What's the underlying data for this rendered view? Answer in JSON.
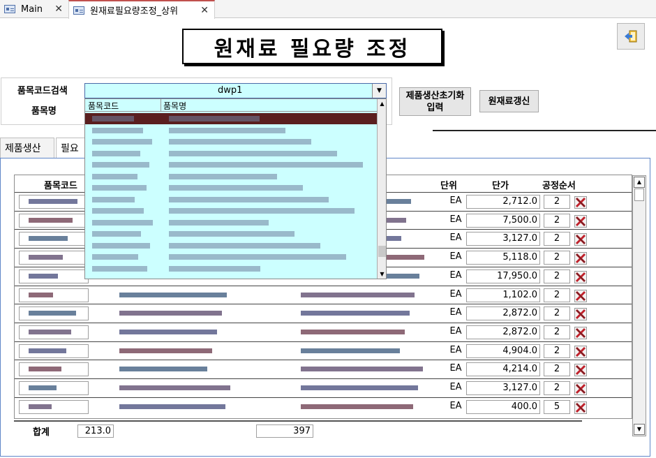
{
  "tabs": [
    {
      "label": "Main",
      "active": false
    },
    {
      "label": "원재료필요량조정_상위",
      "active": true
    }
  ],
  "title": "원재료 필요량 조정",
  "search": {
    "code_label": "품목코드검색",
    "name_label": "품목명",
    "combo_value": "dwp1",
    "list_col1": "품목코드",
    "list_col2": "품목명"
  },
  "buttons": {
    "init_label": "제품생산초기화\n입력",
    "refresh_label": "원재료갱신"
  },
  "subtabs": [
    "제품생산",
    "필요"
  ],
  "grid": {
    "headers": {
      "code": "품목코드",
      "unit": "단위",
      "price": "단가",
      "seq": "공정순서"
    },
    "rows": [
      {
        "unit": "EA",
        "price": "2,712.0",
        "seq": "2"
      },
      {
        "unit": "EA",
        "price": "7,500.0",
        "seq": "2"
      },
      {
        "unit": "EA",
        "price": "3,127.0",
        "seq": "2"
      },
      {
        "unit": "EA",
        "price": "5,118.0",
        "seq": "2"
      },
      {
        "unit": "EA",
        "price": "17,950.0",
        "seq": "2"
      },
      {
        "unit": "EA",
        "price": "1,102.0",
        "seq": "2"
      },
      {
        "unit": "EA",
        "price": "2,872.0",
        "seq": "2"
      },
      {
        "unit": "EA",
        "price": "2,872.0",
        "seq": "2"
      },
      {
        "unit": "EA",
        "price": "4,904.0",
        "seq": "2"
      },
      {
        "unit": "EA",
        "price": "4,214.0",
        "seq": "2"
      },
      {
        "unit": "EA",
        "price": "3,127.0",
        "seq": "2"
      },
      {
        "unit": "EA",
        "price": "400.0",
        "seq": "5"
      }
    ]
  },
  "totals": {
    "label": "합계",
    "value1": "213.0",
    "value2": "397"
  },
  "colors": {
    "accent_tab": "#c0504d",
    "combo_bg": "#ccffff",
    "frame": "#5f86c8",
    "delete_icon": "#c0202a"
  },
  "icons": {
    "exit": "exit-door-icon",
    "delete": "delete-x-icon",
    "form": "form-icon"
  }
}
